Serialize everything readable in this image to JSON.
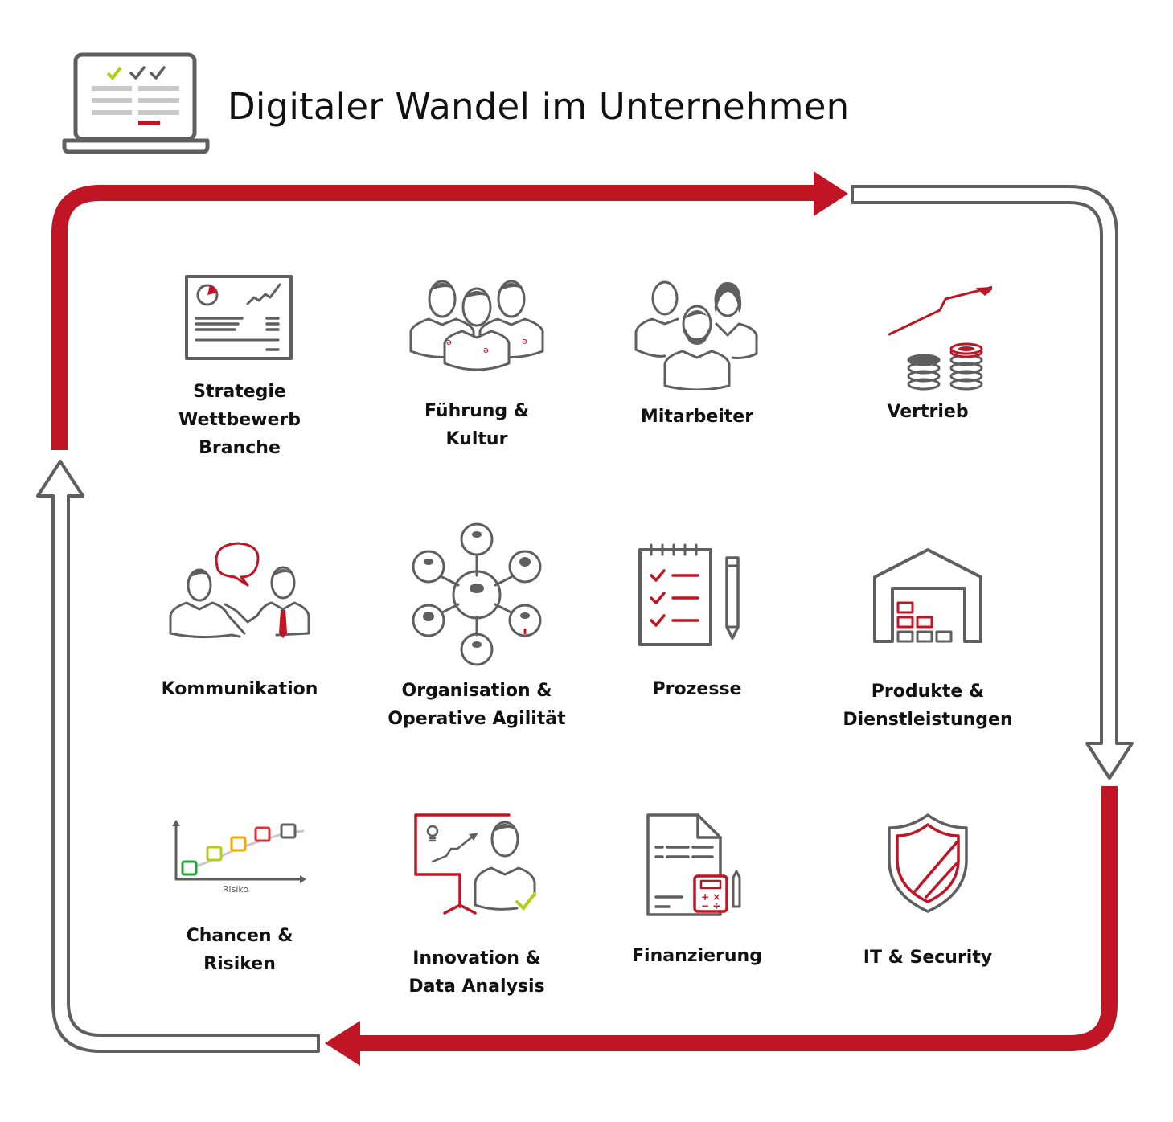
{
  "header": {
    "title": "Digitaler Wandel im Unternehmen",
    "icon": "laptop-checklist-icon"
  },
  "colors": {
    "accent_red": "#c01525",
    "gray": "#5f5f5f",
    "light_gray": "#c9c9c9",
    "lime": "#b5cc18"
  },
  "cycle": {
    "description": "Kreislauf-Pfeile um die Themenfelder",
    "segments": [
      {
        "side": "top",
        "style": "solid-red",
        "direction": "right"
      },
      {
        "side": "right",
        "style": "outline-gray",
        "direction": "down"
      },
      {
        "side": "bottom",
        "style": "solid-red",
        "direction": "left"
      },
      {
        "side": "left",
        "style": "outline-gray",
        "direction": "up"
      }
    ]
  },
  "topics": [
    {
      "label": "Strategie\nWettbewerb\nBranche",
      "icon": "strategy-board-icon"
    },
    {
      "label": "Führung &\nKultur",
      "icon": "leadership-team-icon"
    },
    {
      "label": "Mitarbeiter",
      "icon": "employees-icon"
    },
    {
      "label": "Vertrieb",
      "icon": "sales-coins-icon"
    },
    {
      "label": "Kommunikation",
      "icon": "communication-icon"
    },
    {
      "label": "Organisation &\nOperative Agilität",
      "icon": "organisation-network-icon"
    },
    {
      "label": "Prozesse",
      "icon": "process-checklist-icon"
    },
    {
      "label": "Produkte &\nDienstleistungen",
      "icon": "warehouse-icon"
    },
    {
      "label": "Chancen &\nRisiken",
      "icon": "risk-chart-icon"
    },
    {
      "label": "Innovation &\nData Analysis",
      "icon": "innovation-presentation-icon"
    },
    {
      "label": "Finanzierung",
      "icon": "finance-calculator-icon"
    },
    {
      "label": "IT & Security",
      "icon": "security-shield-icon"
    }
  ],
  "risk_chart": {
    "axis_label": "Risiko"
  }
}
